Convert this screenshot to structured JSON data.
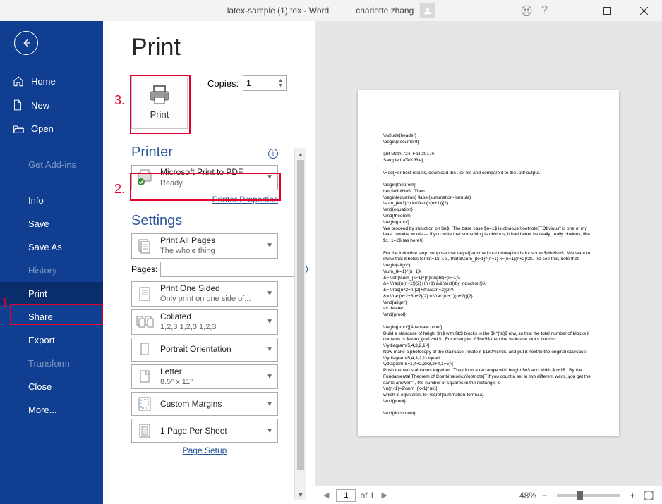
{
  "titlebar": {
    "doc_title": "latex-sample (1).tex  -  Word",
    "user": "charlotte zhang"
  },
  "sidebar": {
    "home": "Home",
    "new": "New",
    "open": "Open",
    "get_addins": "Get Add-ins",
    "info": "Info",
    "save": "Save",
    "save_as": "Save As",
    "history": "History",
    "print": "Print",
    "share": "Share",
    "export": "Export",
    "transform": "Transform",
    "close": "Close",
    "more": "More..."
  },
  "print": {
    "heading": "Print",
    "button": "Print",
    "copies_label": "Copies:",
    "copies_value": "1",
    "printer_h": "Printer",
    "printer_name": "Microsoft Print to PDF",
    "printer_status": "Ready",
    "printer_props": "Printer Properties",
    "settings_h": "Settings",
    "s1_t": "Print All Pages",
    "s1_s": "The whole thing",
    "pages_label": "Pages:",
    "s2_t": "Print One Sided",
    "s2_s": "Only print on one side of...",
    "s3_t": "Collated",
    "s3_s": "1,2,3    1,2,3    1,2,3",
    "s4_t": "Portrait Orientation",
    "s5_t": "Letter",
    "s5_s": "8.5\" x 11\"",
    "s6_t": "Custom Margins",
    "s7_t": "1 Page Per Sheet",
    "page_setup": "Page Setup"
  },
  "preview": {
    "page_current": "1",
    "page_of": "of 1",
    "zoom": "48%",
    "content": "\\include{header}\n\\begin{document}\n\n{\\bf Math 724, Fall 2017\\\\\nSample LaTeX File}\n\n\\Red{For best results, download the .tex file and compare it to the .pdf output.}\n\n\\begin{theorem}\nLet $n\\in\\Nn$.  Then\n\\begin{equation} \\label{summation-formula}\n\\sum_{k=1}^n k=\\frac{n(n+1)}{2}.\n\\end{equation}\n\\end{theorem}\n\\begin{proof}\nWe proceed by induction on $n$.  The base case $n=1$ is obvious.\\footnote{``Obvious'' is one of my least favorite words --- if you write that something is obvious, it had better be really, really obvious, like $1+1=2$ (as here!)}\n\nFor the inductive step, suppose that \\eqref{summation-formula} holds for some $n\\in\\Nn$.  We want to show that it holds for $n+1$, i.e., that $\\sum_{k=1}^{n+1} k=(n+1)(n+2)/2$.  To see this, note that\n\\begin{align*}\n\\sum_{k=1}^{n+1}k\n&= \\left(\\sum_{k=1}^{n}k\\right)+(n+1)\\\\\n&= \\frac{n(n+1)}{2}+(n+1) && \\text{(by induction)}\\\\\n&= \\frac{n^2+n}{2}+\\frac{2n+2}{2}\\\\\n&= \\frac{n^2+3n+2}{2} = \\frac{(n+1)(n+2)}{2}\n\\end{align*}\nas desired.\n\\end{proof}\n\n\\begin{proof}[Alternate proof]\nBuild a staircase of height $n$ with $k$ blocks in the $k^{th}$ row, so that the total number of blocks it contains is $\\sum_{k=1}^nk$.  For example, if $n=5$ then the staircase looks like this:\n\\[\\ydiagram{5,4,3,2,1}\\]\nNow make a photocopy of the staircase, rotate it $180^\\circ$, and put it next to the original staircase:\n\\[\\ydiagram{5,4,3,2,1} \\quad\n\\ydiagram{5+1,4+2,3+3,2+4,1+5}\\]\nPush the two staircases together.  They form a rectangle with height $n$ and width $n+1$.  By the Fundamental Theorem of Combinatorics\\footnote{``If you count a set in two different ways, you get the same answer.''}, the number of squares in the rectangle is\n\\[n(n+1)=2\\sum_{k=1}^nk\\]\nwhich is equivalent to~\\eqref{summation-formula}.\n\\end{proof}\n\n\\end{document}"
  },
  "annotations": {
    "n1": "1.",
    "n2": "2.",
    "n3": "3."
  }
}
